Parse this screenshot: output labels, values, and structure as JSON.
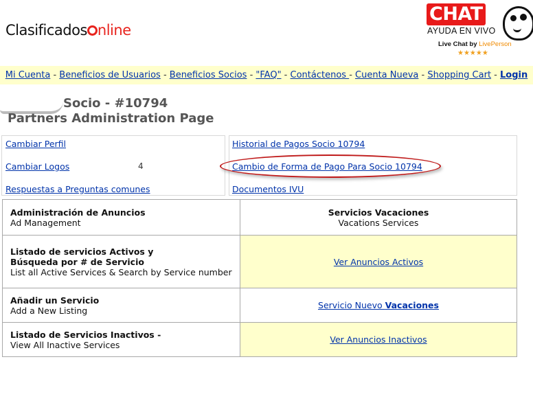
{
  "header": {
    "logo_text": "Clasificados",
    "logo_suffix": "nline",
    "chat_label": "CHAT",
    "chat_sub": "AYUDA EN VIVO",
    "chat_by": "Live Chat by",
    "chat_by_brand": "LivePerson",
    "chat_stars": "★★★★★"
  },
  "nav": {
    "items": [
      "Mi Cuenta",
      "Beneficios de Usuarios",
      "Beneficios Socios",
      "\"FAQ\"",
      "Contáctenos ",
      "Cuenta Nueva",
      "Shopping Cart",
      "Login"
    ],
    "separator": " - "
  },
  "page": {
    "title_line1": "Socio - #10794",
    "title_line2": "Partners Administration Page"
  },
  "left_links": {
    "cambiar_perfil": "Cambiar Perfil",
    "cambiar_logos": "Cambiar Logos",
    "logos_tail": "4",
    "respuestas": "Respuestas a Preguntas comunes"
  },
  "right_links": {
    "historial": "Historial de Pagos Socio 10794",
    "cambio_forma": "Cambio de Forma de Pago Para Socio 10794",
    "documentos": "Documentos IVU"
  },
  "table": {
    "header": {
      "left_title": "Administración de Anuncios",
      "left_sub": "Ad Management",
      "right_title": "Servicios Vacaciones",
      "right_sub": "Vacations Services"
    },
    "rows": [
      {
        "title": "Listado de servicios Activos y",
        "title2": "Búsqueda por # de Servicio",
        "sub": "List all Active Services & Search by Service number",
        "link": "Ver Anuncios Activos"
      },
      {
        "title": "Añadir un Servicio",
        "sub": "Add a New Listing",
        "link_prefix": "Servicio Nuevo ",
        "link_bold": "Vacaciones"
      },
      {
        "title": "Listado de Servicios Inactivos -",
        "sub": "View All Inactive Services",
        "link": "Ver Anuncios Inactivos"
      }
    ]
  },
  "colors": {
    "brand_red": "#e8241e",
    "nav_bg": "#ffffcc",
    "link": "#0033aa",
    "highlight_ellipse": "#c01a1a"
  }
}
